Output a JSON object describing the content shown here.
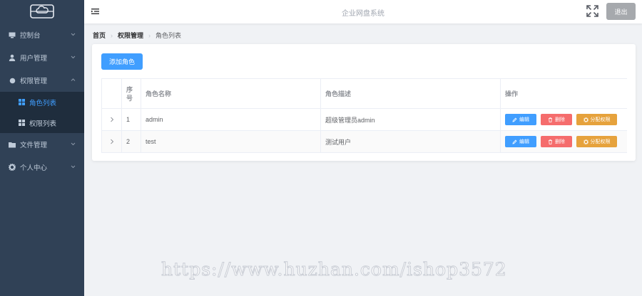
{
  "sidebar": {
    "logo_icon": "cloud-drive-icon",
    "menu": [
      {
        "label": "控制台",
        "icon": "monitor-icon",
        "expanded": false
      },
      {
        "label": "用户管理",
        "icon": "user-icon",
        "expanded": false
      },
      {
        "label": "权限管理",
        "icon": "lock-icon",
        "expanded": true,
        "children": [
          {
            "label": "角色列表",
            "icon": "grid-icon",
            "active": true
          },
          {
            "label": "权限列表",
            "icon": "grid-icon",
            "active": false
          }
        ]
      },
      {
        "label": "文件管理",
        "icon": "folder-icon",
        "expanded": false
      },
      {
        "label": "个人中心",
        "icon": "gear-icon",
        "expanded": false
      }
    ]
  },
  "navbar": {
    "title": "企业网盘系统",
    "logout_label": "退出"
  },
  "breadcrumb": [
    "首页",
    "权限管理",
    "角色列表"
  ],
  "page": {
    "add_button_label": "添加角色",
    "table": {
      "headers": {
        "index": "序号",
        "name": "角色名称",
        "desc": "角色描述",
        "ops": "操作"
      },
      "rows": [
        {
          "index": "1",
          "name": "admin",
          "desc": "超级管理员admin"
        },
        {
          "index": "2",
          "name": "test",
          "desc": "测试用户"
        }
      ],
      "ops": {
        "edit": "编辑",
        "delete": "删除",
        "assign": "分配权限"
      }
    }
  },
  "watermark": "https://www.huzhan.com/ishop3572",
  "colors": {
    "sidebar_bg": "#304156",
    "primary": "#409eff",
    "danger": "#f56c6c",
    "warning": "#e6a23c",
    "logout_bg": "#a6a9ad"
  }
}
